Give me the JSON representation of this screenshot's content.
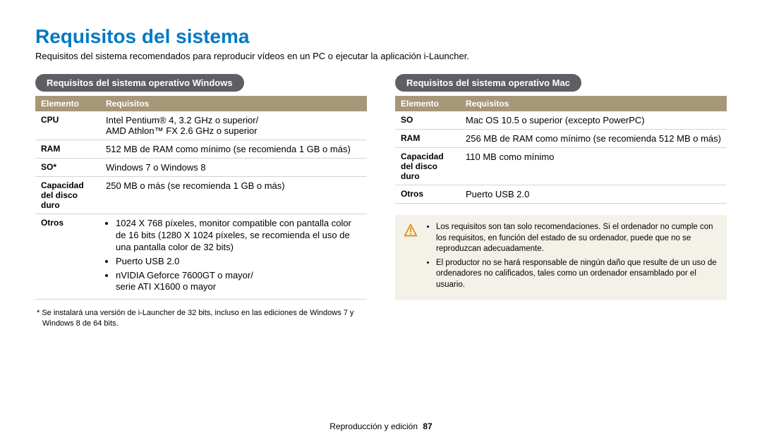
{
  "title": "Requisitos del sistema",
  "intro": "Requisitos del sistema recomendados para reproducir vídeos en un PC o ejecutar la aplicación i-Launcher.",
  "col_headers": {
    "element": "Elemento",
    "reqs": "Requisitos"
  },
  "windows": {
    "heading": "Requisitos del sistema operativo Windows",
    "rows": {
      "cpu": {
        "label": "CPU",
        "line1": "Intel Pentium® 4, 3.2 GHz o superior/",
        "line2": "AMD Athlon™ FX 2.6 GHz o superior"
      },
      "ram": {
        "label": "RAM",
        "value": "512 MB de RAM como mínimo (se recomienda 1 GB o más)"
      },
      "so": {
        "label": "SO*",
        "value": "Windows 7 o Windows 8"
      },
      "hdd": {
        "label": "Capacidad del disco duro",
        "value": "250 MB o más (se recomienda 1 GB o más)"
      },
      "otros": {
        "label": "Otros",
        "bullet1": "1024 X 768 píxeles, monitor compatible con pantalla color de 16 bits (1280 X 1024 píxeles, se recomienda el uso de una pantalla color de 32 bits)",
        "bullet2": "Puerto USB 2.0",
        "bullet3a": "nVIDIA Geforce 7600GT o mayor/",
        "bullet3b": "serie ATI X1600 o mayor"
      }
    },
    "footnote": "*  Se instalará una versión de i-Launcher de 32 bits, incluso en las ediciones de Windows 7 y Windows 8 de 64 bits."
  },
  "mac": {
    "heading": "Requisitos del sistema operativo Mac",
    "rows": {
      "so": {
        "label": "SO",
        "value": "Mac OS 10.5 o superior (excepto PowerPC)"
      },
      "ram": {
        "label": "RAM",
        "value": "256 MB de RAM como mínimo (se recomienda 512 MB o más)"
      },
      "hdd": {
        "label": "Capacidad del disco duro",
        "value": "110 MB como mínimo"
      },
      "otros": {
        "label": "Otros",
        "value": "Puerto USB 2.0"
      }
    }
  },
  "notes": {
    "n1": "Los requisitos son tan solo recomendaciones. Si el ordenador no cumple con los requisitos, en función del estado de su ordenador, puede que no se reproduzcan adecuadamente.",
    "n2": "El productor no se hará responsable de ningún daño que resulte de un uso de ordenadores no calificados, tales como un ordenador ensamblado por el usuario."
  },
  "footer": {
    "section": "Reproducción y edición",
    "page": "87"
  }
}
